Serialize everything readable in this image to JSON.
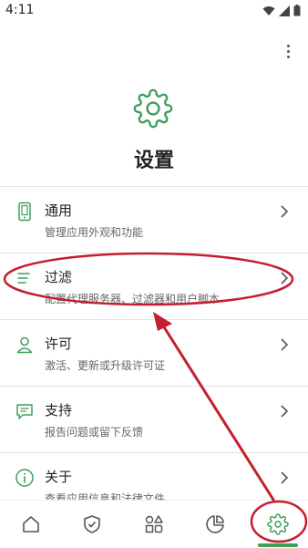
{
  "status_bar": {
    "time": "4:11"
  },
  "header": {
    "title": "设置",
    "icon": "gear-icon"
  },
  "items": [
    {
      "title": "通用",
      "subtitle": "管理应用外观和功能",
      "icon": "phone-icon"
    },
    {
      "title": "过滤",
      "subtitle": "配置代理服务器、过滤器和用户脚本",
      "icon": "filter-lines-icon"
    },
    {
      "title": "许可",
      "subtitle": "激活、更新或升级许可证",
      "icon": "user-icon"
    },
    {
      "title": "支持",
      "subtitle": "报告问题或留下反馈",
      "icon": "chat-icon"
    },
    {
      "title": "关于",
      "subtitle": "查看应用信息和法律文件",
      "icon": "info-icon"
    }
  ],
  "bottom_nav": [
    {
      "name": "home",
      "icon": "home-icon"
    },
    {
      "name": "protection",
      "icon": "shield-check-icon"
    },
    {
      "name": "apps",
      "icon": "grid-icon"
    },
    {
      "name": "statistics",
      "icon": "pie-chart-icon"
    },
    {
      "name": "settings",
      "icon": "gear-icon",
      "active": true
    }
  ],
  "colors": {
    "accent": "#3f9e5a",
    "annotation": "#c41f2c"
  }
}
